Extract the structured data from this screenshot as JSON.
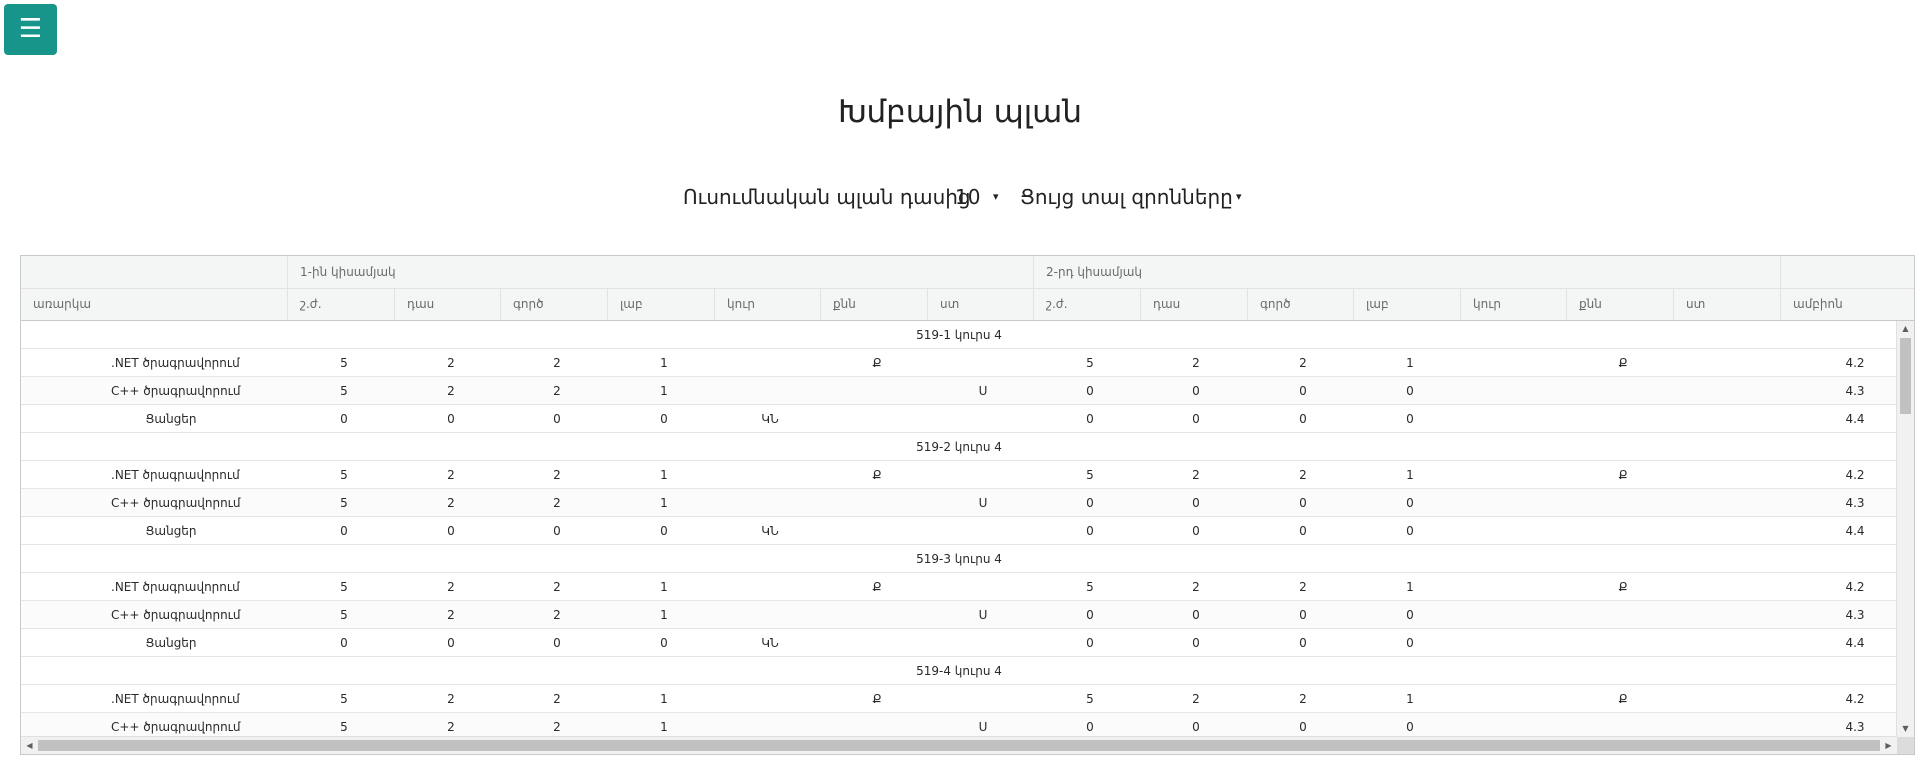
{
  "menu": {
    "icon": "hamburger-icon",
    "glyph": "☰",
    "color": "#17958a"
  },
  "page": {
    "title": "Խմբային պլան"
  },
  "controls": {
    "plan_label": "Ուսումնական պլան դասից",
    "plan_value": "10",
    "show_label": "Ցույց տալ զրոնները",
    "arrow": "▾"
  },
  "grid": {
    "semesters": [
      "1-ին կիսամյակ",
      "2-րդ կիսամյակ",
      ""
    ],
    "columns": [
      "առարկա",
      "շ.ժ.",
      "դաս",
      "գործ",
      "լաբ",
      "կուր",
      "քնն",
      "ստ",
      "շ.ժ.",
      "դաս",
      "գործ",
      "լաբ",
      "կուր",
      "քնն",
      "ստ",
      "ամբիոն"
    ],
    "groups": [
      {
        "label": "519-1 կուրս 4",
        "rows": [
          [
            ".NET ծրագրավորում",
            "5",
            "2",
            "2",
            "1",
            "",
            "Ք",
            "",
            "5",
            "2",
            "2",
            "1",
            "",
            "Ք",
            "",
            "4.2"
          ],
          [
            "C++ ծրագրավորում",
            "5",
            "2",
            "2",
            "1",
            "",
            "",
            "Ս",
            "0",
            "0",
            "0",
            "0",
            "",
            "",
            "",
            "4.3"
          ],
          [
            "Ցանցեր",
            "0",
            "0",
            "0",
            "0",
            "ԿՆ",
            "",
            "",
            "0",
            "0",
            "0",
            "0",
            "",
            "",
            "",
            "4.4"
          ]
        ]
      },
      {
        "label": "519-2 կուրս 4",
        "rows": [
          [
            ".NET ծրագրավորում",
            "5",
            "2",
            "2",
            "1",
            "",
            "Ք",
            "",
            "5",
            "2",
            "2",
            "1",
            "",
            "Ք",
            "",
            "4.2"
          ],
          [
            "C++ ծրագրավորում",
            "5",
            "2",
            "2",
            "1",
            "",
            "",
            "Ս",
            "0",
            "0",
            "0",
            "0",
            "",
            "",
            "",
            "4.3"
          ],
          [
            "Ցանցեր",
            "0",
            "0",
            "0",
            "0",
            "ԿՆ",
            "",
            "",
            "0",
            "0",
            "0",
            "0",
            "",
            "",
            "",
            "4.4"
          ]
        ]
      },
      {
        "label": "519-3 կուրս 4",
        "rows": [
          [
            ".NET ծրագրավորում",
            "5",
            "2",
            "2",
            "1",
            "",
            "Ք",
            "",
            "5",
            "2",
            "2",
            "1",
            "",
            "Ք",
            "",
            "4.2"
          ],
          [
            "C++ ծրագրավորում",
            "5",
            "2",
            "2",
            "1",
            "",
            "",
            "Ս",
            "0",
            "0",
            "0",
            "0",
            "",
            "",
            "",
            "4.3"
          ],
          [
            "Ցանցեր",
            "0",
            "0",
            "0",
            "0",
            "ԿՆ",
            "",
            "",
            "0",
            "0",
            "0",
            "0",
            "",
            "",
            "",
            "4.4"
          ]
        ]
      },
      {
        "label": "519-4 կուրս 4",
        "rows": [
          [
            ".NET ծրագրավորում",
            "5",
            "2",
            "2",
            "1",
            "",
            "Ք",
            "",
            "5",
            "2",
            "2",
            "1",
            "",
            "Ք",
            "",
            "4.2"
          ],
          [
            "C++ ծրագրավորում",
            "5",
            "2",
            "2",
            "1",
            "",
            "",
            "Ս",
            "0",
            "0",
            "0",
            "0",
            "",
            "",
            "",
            "4.3"
          ]
        ]
      }
    ]
  },
  "scrollbars": {
    "up": "▲",
    "down": "▼",
    "left": "◀",
    "right": "▶"
  }
}
